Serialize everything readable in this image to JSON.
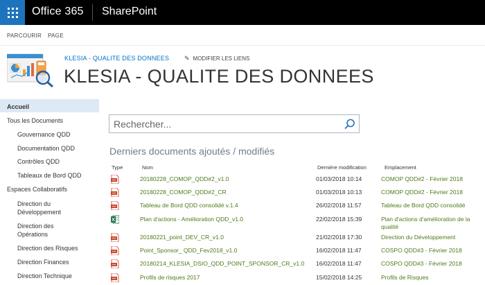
{
  "suitebar": {
    "brand": "Office 365",
    "app": "SharePoint"
  },
  "ribbon": {
    "tabs": [
      "PARCOURIR",
      "PAGE"
    ]
  },
  "site": {
    "breadcrumb": "KLESIA - QUALITE DES DONNEES",
    "edit_links": "MODIFIER LES LIENS",
    "title": "KLESIA - QUALITE DES DONNEES"
  },
  "nav": {
    "items": [
      "Accueil",
      "Tous les Documents",
      "Gouvernance QDD",
      "Documentation QDD",
      "Contrôles QDD",
      "Tableaux de Bord QDD",
      "Espaces Collaboratifs",
      "Direction du",
      "Développement",
      "Direction des",
      "Opérations",
      "Direction des Risques",
      "Direction Finances",
      "Direction Technique"
    ]
  },
  "search": {
    "placeholder": "Rechercher..."
  },
  "documents": {
    "title": "Derniers documents ajoutés / modifiés",
    "columns": [
      "Type",
      "Nom",
      "Dernière modification",
      "Emplacement"
    ],
    "rows": [
      {
        "type": "pdf-icon",
        "name": "20180228_COMOP_QDD#2_v1.0",
        "date": "01/03/2018 10:14",
        "location": "COMOP QDD#2 - Février 2018"
      },
      {
        "type": "pdf-icon",
        "name": "20180228_COMOP_QDD#2_CR",
        "date": "01/03/2018 10:13",
        "location": "COMOP QDD#2 - Février 2018"
      },
      {
        "type": "pdf-icon",
        "name": "Tableau de Bord QDD consolidé v.1.4",
        "date": "26/02/2018 11:57",
        "location": "Tableau de Bord QDD consolidé"
      },
      {
        "type": "excel-icon",
        "name": "Plan d'actions - Amélioration QDD_v1.0",
        "date": "22/02/2018 15:39",
        "location": "Plan d'actions d'amélioration de la qualité"
      },
      {
        "type": "pdf-icon",
        "name": "20180221_point_DEV_CR_v1.0",
        "date": "21/02/2018 17:30",
        "location": "Direction du Développement"
      },
      {
        "type": "pdf-icon",
        "name": "Point_Sponsor_ QDD_Fev2018_v1.0",
        "date": "16/02/2018 11:47",
        "location": "COSPO QDD#3 - Février 2018"
      },
      {
        "type": "pdf-icon",
        "name": "20180214_KLESIA_DSIO_QDD_POINT_SPONSOR_CR_v1.0",
        "date": "16/02/2018 11:47",
        "location": "COSPO QDD#3 - Février 2018"
      },
      {
        "type": "pdf-icon",
        "name": "Profils de risques 2017",
        "date": "15/02/2018 14:25",
        "location": "Profils de Risques"
      }
    ]
  },
  "colors": {
    "suitebar": "#000000",
    "waffle": "#1e73be",
    "link_green": "#4d7a1a",
    "accent_blue": "#0072c6",
    "nav_selected": "#dde9f5"
  }
}
